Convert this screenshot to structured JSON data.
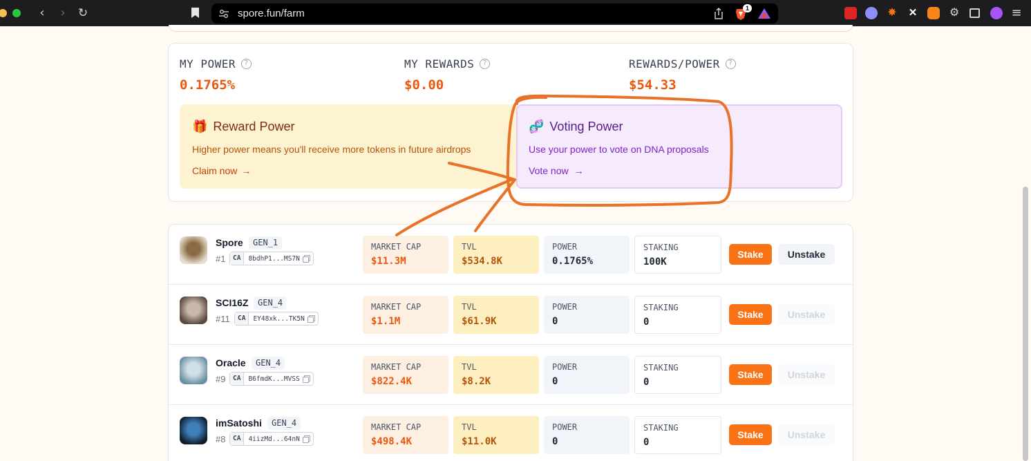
{
  "browser": {
    "url": "spore.fun/farm",
    "brave_badge": "1"
  },
  "stats": {
    "my_power": {
      "label": "MY POWER",
      "value": "0.1765%"
    },
    "my_rewards": {
      "label": "MY REWARDS",
      "value": "$0.00"
    },
    "rewards_per_power": {
      "label": "REWARDS/POWER",
      "value": "$54.33"
    }
  },
  "reward_power": {
    "emoji": "🎁",
    "title": "Reward Power",
    "description": "Higher power means you'll receive more tokens in future airdrops",
    "cta": "Claim now",
    "cta_arrow": "→"
  },
  "voting_power": {
    "emoji": "🧬",
    "title": "Voting Power",
    "description": "Use your power to vote on DNA proposals",
    "cta": "Vote now",
    "cta_arrow": "→"
  },
  "metric_labels": {
    "market_cap": "MARKET CAP",
    "tvl": "TVL",
    "power": "POWER",
    "staking": "STAKING",
    "ca": "CA",
    "stake": "Stake",
    "unstake": "Unstake"
  },
  "tokens": [
    {
      "name": "Spore",
      "gen": "GEN_1",
      "rank": "#1",
      "ca": "8bdhP1...MS7N",
      "market_cap": "$11.3M",
      "tvl": "$534.8K",
      "power": "0.1765%",
      "staking": "100K",
      "unstake_enabled": true
    },
    {
      "name": "SCI16Z",
      "gen": "GEN_4",
      "rank": "#11",
      "ca": "EY48xk...TK5N",
      "market_cap": "$1.1M",
      "tvl": "$61.9K",
      "power": "0",
      "staking": "0",
      "unstake_enabled": false
    },
    {
      "name": "Oracle",
      "gen": "GEN_4",
      "rank": "#9",
      "ca": "B6fmdK...MVSS",
      "market_cap": "$822.4K",
      "tvl": "$8.2K",
      "power": "0",
      "staking": "0",
      "unstake_enabled": false
    },
    {
      "name": "imSatoshi",
      "gen": "GEN_4",
      "rank": "#8",
      "ca": "4iizMd...64nN",
      "market_cap": "$498.4K",
      "tvl": "$11.0K",
      "power": "0",
      "staking": "0",
      "unstake_enabled": false
    }
  ],
  "colors": {
    "accent": "#ea580c",
    "stake_button": "#f97316",
    "annotation": "#e8722a"
  }
}
